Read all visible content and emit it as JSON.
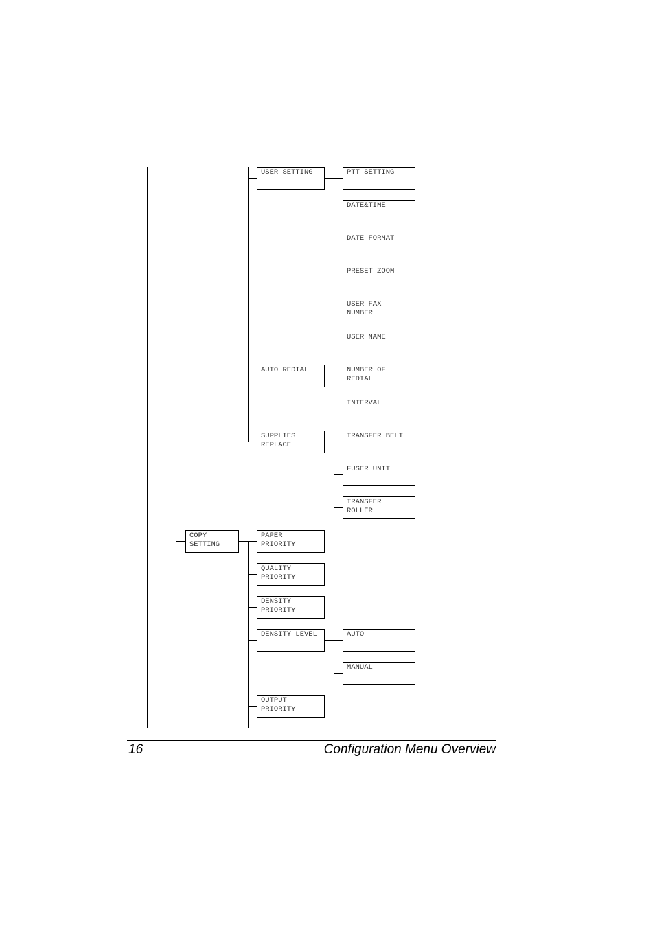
{
  "menu_tree": {
    "user_setting": {
      "label": "USER SETTING",
      "children": [
        "PTT SETTING",
        "DATE&TIME",
        "DATE FORMAT",
        "PRESET ZOOM",
        "USER FAX\nNUMBER",
        "USER NAME"
      ]
    },
    "auto_redial": {
      "label": "AUTO REDIAL",
      "children": [
        "NUMBER OF\nREDIAL",
        "INTERVAL"
      ]
    },
    "supplies_replace": {
      "label": "SUPPLIES\nREPLACE",
      "children": [
        "TRANSFER BELT",
        "FUSER UNIT",
        "TRANSFER\nROLLER"
      ]
    },
    "copy_setting": {
      "label": "COPY\nSETTING",
      "children": [
        {
          "label": "PAPER\nPRIORITY"
        },
        {
          "label": "QUALITY\nPRIORITY"
        },
        {
          "label": "DENSITY\nPRIORITY"
        },
        {
          "label": "DENSITY LEVEL",
          "children": [
            "AUTO",
            "MANUAL"
          ]
        },
        {
          "label": "OUTPUT\nPRIORITY"
        }
      ]
    }
  },
  "footer": {
    "page_number": "16",
    "section_title": "Configuration Menu Overview"
  }
}
